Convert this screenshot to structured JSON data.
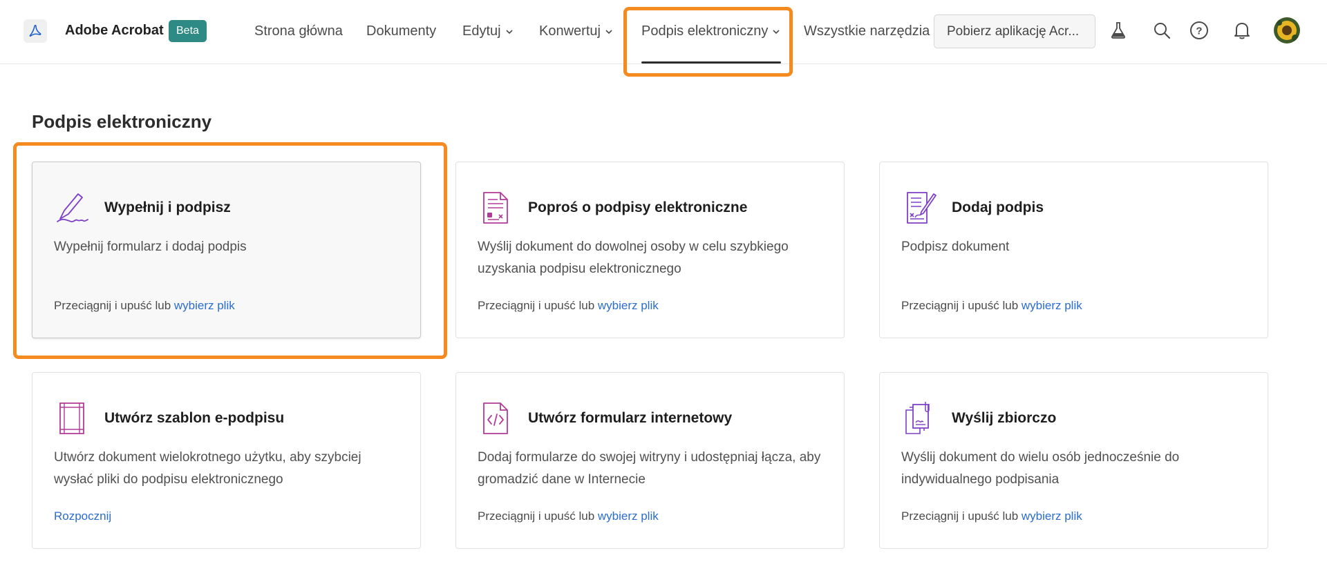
{
  "header": {
    "app_name": "Adobe Acrobat",
    "beta_label": "Beta",
    "nav": [
      {
        "label": "Strona główna",
        "has_menu": false
      },
      {
        "label": "Dokumenty",
        "has_menu": false
      },
      {
        "label": "Edytuj",
        "has_menu": true
      },
      {
        "label": "Konwertuj",
        "has_menu": true
      },
      {
        "label": "Podpis elektroniczny",
        "has_menu": true,
        "active": true
      },
      {
        "label": "Wszystkie narzędzia",
        "has_menu": false
      }
    ],
    "get_app_label": "Pobierz aplikację Acr...",
    "icons": [
      "flask-icon",
      "search-icon",
      "help-icon",
      "bell-icon",
      "avatar"
    ]
  },
  "page": {
    "title": "Podpis elektroniczny",
    "cards": [
      {
        "title": "Wypełnij i podpisz",
        "description": "Wypełnij formularz i dodaj podpis",
        "foot_text": "Przeciągnij i upuść lub ",
        "foot_link": "wybierz plik",
        "icon": "fill-sign-icon"
      },
      {
        "title": "Poproś o podpisy elektroniczne",
        "description": "Wyślij dokument do dowolnej osoby w celu szybkiego uzyskania podpisu elektronicznego",
        "foot_text": "Przeciągnij i upuść lub ",
        "foot_link": "wybierz plik",
        "icon": "request-signatures-icon"
      },
      {
        "title": "Dodaj podpis",
        "description": "Podpisz dokument",
        "foot_text": "Przeciągnij i upuść lub ",
        "foot_link": "wybierz plik",
        "icon": "add-signature-icon"
      },
      {
        "title": "Utwórz szablon e-podpisu",
        "description": "Utwórz dokument wielokrotnego użytku, aby szybciej wysłać pliki do podpisu elektronicznego",
        "foot_text": "",
        "foot_link": "Rozpocznij",
        "icon": "template-icon"
      },
      {
        "title": "Utwórz formularz internetowy",
        "description": "Dodaj formularze do swojej witryny i udostępniaj łącza, aby gromadzić dane w Internecie",
        "foot_text": "Przeciągnij i upuść lub ",
        "foot_link": "wybierz plik",
        "icon": "web-form-icon"
      },
      {
        "title": "Wyślij zbiorczo",
        "description": "Wyślij dokument do wielu osób jednocześnie do indywidualnego podpisania",
        "foot_text": "Przeciągnij i upuść lub ",
        "foot_link": "wybierz plik",
        "icon": "bulk-send-icon"
      }
    ]
  },
  "colors": {
    "accent_purple": "#7d3fc6",
    "accent_magenta": "#b33a9a",
    "link_blue": "#2a6ccf",
    "highlight_orange": "#f58a1f",
    "beta_teal": "#2d8a85"
  }
}
